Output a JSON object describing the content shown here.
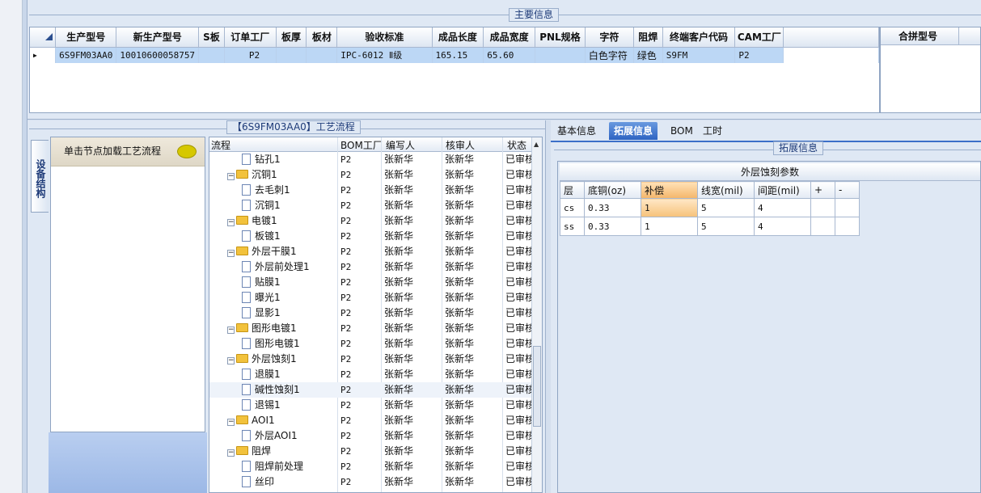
{
  "main_info": {
    "legend": "主要信息",
    "columns": [
      "生产型号",
      "新生产型号",
      "S板",
      "订单工厂",
      "板厚",
      "板材",
      "验收标准",
      "成品长度",
      "成品宽度",
      "PNL规格",
      "字符",
      "阻焊",
      "终端客户代码",
      "CAM工厂"
    ],
    "row": [
      "6S9FM03AA0",
      "10010600058757",
      "",
      "P2",
      "",
      "",
      "IPC-6012 Ⅱ级",
      "165.15",
      "65.60",
      "",
      "白色字符",
      "绿色",
      "S9FM",
      "P2"
    ],
    "side_column": "合拼型号"
  },
  "process": {
    "legend": "【6S9FM03AA0】工艺流程",
    "vertical_tab": "设备结构",
    "load_hint": "单击节点加载工艺流程",
    "headers": [
      "流程",
      "BOM工厂",
      "编写人",
      "核审人",
      "状态"
    ],
    "rows": [
      {
        "name": "钻孔1",
        "level": 2,
        "type": "doc",
        "bom": "P2",
        "writer": "张新华",
        "reviewer": "张新华",
        "status": "已审核"
      },
      {
        "name": "沉铜1",
        "level": 1,
        "type": "folder",
        "bom": "P2",
        "writer": "张新华",
        "reviewer": "张新华",
        "status": "已审核"
      },
      {
        "name": "去毛刺1",
        "level": 2,
        "type": "doc",
        "bom": "P2",
        "writer": "张新华",
        "reviewer": "张新华",
        "status": "已审核"
      },
      {
        "name": "沉铜1",
        "level": 2,
        "type": "doc",
        "bom": "P2",
        "writer": "张新华",
        "reviewer": "张新华",
        "status": "已审核"
      },
      {
        "name": "电镀1",
        "level": 1,
        "type": "folder",
        "bom": "P2",
        "writer": "张新华",
        "reviewer": "张新华",
        "status": "已审核"
      },
      {
        "name": "板镀1",
        "level": 2,
        "type": "doc",
        "bom": "P2",
        "writer": "张新华",
        "reviewer": "张新华",
        "status": "已审核"
      },
      {
        "name": "外层干膜1",
        "level": 1,
        "type": "folder",
        "bom": "P2",
        "writer": "张新华",
        "reviewer": "张新华",
        "status": "已审核"
      },
      {
        "name": "外层前处理1",
        "level": 2,
        "type": "doc",
        "bom": "P2",
        "writer": "张新华",
        "reviewer": "张新华",
        "status": "已审核"
      },
      {
        "name": "贴膜1",
        "level": 2,
        "type": "doc",
        "bom": "P2",
        "writer": "张新华",
        "reviewer": "张新华",
        "status": "已审核"
      },
      {
        "name": "曝光1",
        "level": 2,
        "type": "doc",
        "bom": "P2",
        "writer": "张新华",
        "reviewer": "张新华",
        "status": "已审核"
      },
      {
        "name": "显影1",
        "level": 2,
        "type": "doc",
        "bom": "P2",
        "writer": "张新华",
        "reviewer": "张新华",
        "status": "已审核"
      },
      {
        "name": "图形电镀1",
        "level": 1,
        "type": "folder",
        "bom": "P2",
        "writer": "张新华",
        "reviewer": "张新华",
        "status": "已审核"
      },
      {
        "name": "图形电镀1",
        "level": 2,
        "type": "doc",
        "bom": "P2",
        "writer": "张新华",
        "reviewer": "张新华",
        "status": "已审核"
      },
      {
        "name": "外层蚀刻1",
        "level": 1,
        "type": "folder",
        "bom": "P2",
        "writer": "张新华",
        "reviewer": "张新华",
        "status": "已审核"
      },
      {
        "name": "退膜1",
        "level": 2,
        "type": "doc",
        "bom": "P2",
        "writer": "张新华",
        "reviewer": "张新华",
        "status": "已审核"
      },
      {
        "name": "碱性蚀刻1",
        "level": 2,
        "type": "doc",
        "bom": "P2",
        "writer": "张新华",
        "reviewer": "张新华",
        "status": "已审核",
        "selected": true
      },
      {
        "name": "退锡1",
        "level": 2,
        "type": "doc",
        "bom": "P2",
        "writer": "张新华",
        "reviewer": "张新华",
        "status": "已审核"
      },
      {
        "name": "AOI1",
        "level": 1,
        "type": "folder",
        "bom": "P2",
        "writer": "张新华",
        "reviewer": "张新华",
        "status": "已审核"
      },
      {
        "name": "外层AOI1",
        "level": 2,
        "type": "doc",
        "bom": "P2",
        "writer": "张新华",
        "reviewer": "张新华",
        "status": "已审核"
      },
      {
        "name": "阻焊",
        "level": 1,
        "type": "folder",
        "bom": "P2",
        "writer": "张新华",
        "reviewer": "张新华",
        "status": "已审核"
      },
      {
        "name": "阻焊前处理",
        "level": 2,
        "type": "doc",
        "bom": "P2",
        "writer": "张新华",
        "reviewer": "张新华",
        "status": "已审核"
      },
      {
        "name": "丝印",
        "level": 2,
        "type": "doc",
        "bom": "P2",
        "writer": "张新华",
        "reviewer": "张新华",
        "status": "已审核"
      }
    ]
  },
  "detail": {
    "tabs": [
      "基本信息",
      "拓展信息",
      "BOM",
      "工时"
    ],
    "active_tab": "拓展信息",
    "legend": "拓展信息",
    "table_title": "外层蚀刻参数",
    "headers": [
      "层",
      "底铜(oz)",
      "补偿",
      "线宽(mil)",
      "间距(mil)",
      "+",
      "-"
    ],
    "rows": [
      [
        "cs",
        "0.33",
        "1",
        "5",
        "4",
        "",
        ""
      ],
      [
        "ss",
        "0.33",
        "1",
        "5",
        "4",
        "",
        ""
      ]
    ]
  }
}
